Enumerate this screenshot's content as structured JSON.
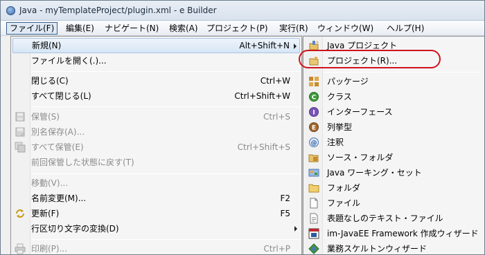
{
  "window": {
    "title": "Java - myTemplateProject/plugin.xml - e Builder",
    "app_icon": "eclipse-icon"
  },
  "menubar": {
    "items": [
      {
        "label": "ファイル(F)",
        "active": true
      },
      {
        "label": "編集(E)"
      },
      {
        "label": "ナビゲート(N)"
      },
      {
        "label": "検索(A)"
      },
      {
        "label": "プロジェクト(P)"
      },
      {
        "label": "実行(R)"
      },
      {
        "label": "ウィンドウ(W)"
      },
      {
        "label": "ヘルプ(H)"
      }
    ]
  },
  "file_menu": {
    "items": [
      {
        "label": "新規(N)",
        "accel": "Alt+Shift+N",
        "submenu": true,
        "highlighted": true
      },
      {
        "label": "ファイルを開く(.)..."
      },
      {
        "label": "閉じる(C)",
        "accel": "Ctrl+W"
      },
      {
        "label": "すべて閉じる(L)",
        "accel": "Ctrl+Shift+W"
      },
      {
        "label": "保管(S)",
        "accel": "Ctrl+S",
        "disabled": true,
        "icon": "save-icon"
      },
      {
        "label": "別名保存(A)...",
        "disabled": true,
        "icon": "save-as-icon"
      },
      {
        "label": "すべて保管(E)",
        "accel": "Ctrl+Shift+S",
        "disabled": true,
        "icon": "save-all-icon"
      },
      {
        "label": "前回保管した状態に戻す(T)",
        "disabled": true
      },
      {
        "label": "移動(V)...",
        "disabled": true
      },
      {
        "label": "名前変更(M)...",
        "accel": "F2"
      },
      {
        "label": "更新(F)",
        "accel": "F5",
        "icon": "refresh-icon"
      },
      {
        "label": "行区切り文字の変換(D)",
        "submenu": true
      },
      {
        "label": "印刷(P)...",
        "accel": "Ctrl+P",
        "disabled": true,
        "icon": "print-icon"
      }
    ]
  },
  "new_submenu": {
    "items": [
      {
        "label": "Java プロジェクト",
        "icon": "java-project-icon"
      },
      {
        "label": "プロジェクト(R)...",
        "icon": "project-icon",
        "annotated": true
      },
      {
        "label": "パッケージ",
        "icon": "package-icon"
      },
      {
        "label": "クラス",
        "icon": "class-icon"
      },
      {
        "label": "インターフェース",
        "icon": "interface-icon"
      },
      {
        "label": "列挙型",
        "icon": "enum-icon"
      },
      {
        "label": "注釈",
        "icon": "annotation-icon"
      },
      {
        "label": "ソース・フォルダ",
        "icon": "source-folder-icon"
      },
      {
        "label": "Java ワーキング・セット",
        "icon": "working-set-icon"
      },
      {
        "label": "フォルダ",
        "icon": "folder-icon"
      },
      {
        "label": "ファイル",
        "icon": "file-icon"
      },
      {
        "label": "表題なしのテキスト・ファイル",
        "icon": "untitled-text-file-icon"
      },
      {
        "label": "im-JavaEE Framework 作成ウィザード",
        "icon": "framework-wizard-icon"
      },
      {
        "label": "業務スケルトンウィザード",
        "icon": "skeleton-wizard-icon"
      }
    ]
  },
  "colors": {
    "annotation": "#d0121b",
    "highlight": "#d7e6f6",
    "disabled_text": "#8c8c8c"
  }
}
